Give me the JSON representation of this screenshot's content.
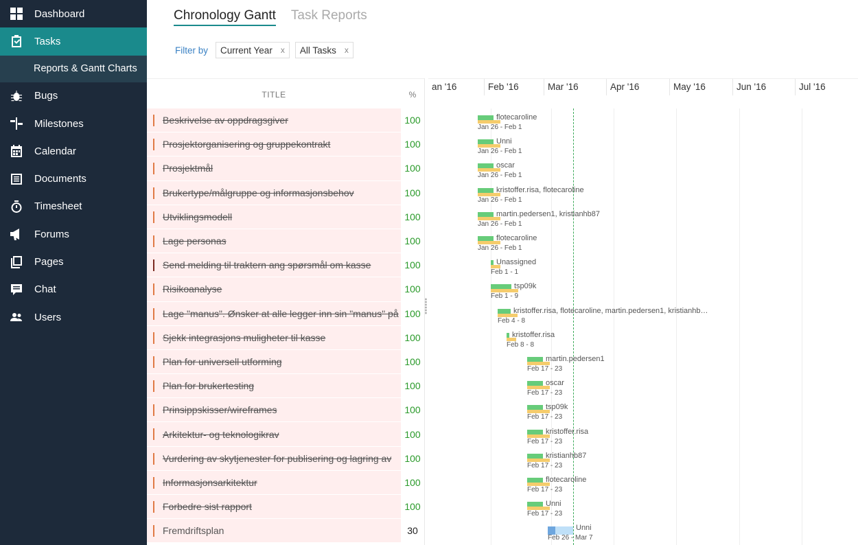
{
  "sidebar": {
    "items": [
      {
        "label": "Dashboard",
        "icon": "dashboard-icon"
      },
      {
        "label": "Tasks",
        "icon": "tasks-icon"
      },
      {
        "label": "Reports & Gantt Charts",
        "icon": ""
      },
      {
        "label": "Bugs",
        "icon": "bug-icon"
      },
      {
        "label": "Milestones",
        "icon": "milestones-icon"
      },
      {
        "label": "Calendar",
        "icon": "calendar-icon"
      },
      {
        "label": "Documents",
        "icon": "documents-icon"
      },
      {
        "label": "Timesheet",
        "icon": "timesheet-icon"
      },
      {
        "label": "Forums",
        "icon": "forums-icon"
      },
      {
        "label": "Pages",
        "icon": "pages-icon"
      },
      {
        "label": "Chat",
        "icon": "chat-icon"
      },
      {
        "label": "Users",
        "icon": "users-icon"
      }
    ]
  },
  "header": {
    "tabs": [
      {
        "label": "Chronology Gantt"
      },
      {
        "label": "Task Reports"
      }
    ],
    "filter_label": "Filter by",
    "filters": [
      {
        "label": "Current Year",
        "remove": "x"
      },
      {
        "label": "All Tasks",
        "remove": "x"
      }
    ]
  },
  "grid": {
    "col_title": "TITLE",
    "col_pct": "%",
    "rows": [
      {
        "title": "Beskrivelse av oppdragsgiver",
        "pct": "100"
      },
      {
        "title": "Prosjektorganisering og gruppekontrakt",
        "pct": "100"
      },
      {
        "title": "Prosjektmål",
        "pct": "100"
      },
      {
        "title": "Brukertype/målgruppe og informasjonsbehov",
        "pct": "100"
      },
      {
        "title": "Utviklingsmodell",
        "pct": "100"
      },
      {
        "title": "Lage personas",
        "pct": "100"
      },
      {
        "title": "Send melding til traktern ang spørsmål om kasse",
        "pct": "100"
      },
      {
        "title": "Risikoanalyse",
        "pct": "100"
      },
      {
        "title": "Lage \"manus\". Ønsker at alle legger inn sin \"manus\" på",
        "pct": "100"
      },
      {
        "title": "Sjekk integrasjons muligheter til kasse",
        "pct": "100"
      },
      {
        "title": "Plan for universell utforming",
        "pct": "100"
      },
      {
        "title": "Plan for brukertesting",
        "pct": "100"
      },
      {
        "title": "Prinsippskisser/wireframes",
        "pct": "100"
      },
      {
        "title": "Arkitektur- og teknologikrav",
        "pct": "100"
      },
      {
        "title": "Vurdering av skytjenester for publisering og lagring av",
        "pct": "100"
      },
      {
        "title": "Informasjonsarkitektur",
        "pct": "100"
      },
      {
        "title": "Forbedre sist rapport",
        "pct": "100"
      },
      {
        "title": "Fremdriftsplan",
        "pct": "30"
      }
    ]
  },
  "gantt": {
    "months": [
      "an '16",
      "Feb '16",
      "Mar '16",
      "Apr '16",
      "May '16",
      "Jun '16",
      "Jul '16"
    ],
    "bars": [
      {
        "name": "flotecaroline",
        "dates": "Jan 26 - Feb 1",
        "progress": 1.0
      },
      {
        "name": "Unni",
        "dates": "Jan 26 - Feb 1",
        "progress": 1.0
      },
      {
        "name": "oscar",
        "dates": "Jan 26 - Feb 1",
        "progress": 1.0
      },
      {
        "name": "kristoffer.risa, flotecaroline",
        "dates": "Jan 26 - Feb 1",
        "progress": 1.0
      },
      {
        "name": "martin.pedersen1, kristianhb87",
        "dates": "Jan 26 - Feb 1",
        "progress": 1.0
      },
      {
        "name": "flotecaroline",
        "dates": "Jan 26 - Feb 1",
        "progress": 1.0
      },
      {
        "name": "Unassigned",
        "dates": "Feb 1 - 1",
        "progress": 1.0
      },
      {
        "name": "tsp09k",
        "dates": "Feb 1 - 9",
        "progress": 1.0
      },
      {
        "name": "kristoffer.risa, flotecaroline, martin.pedersen1, kristianhb…",
        "dates": "Feb 4 - 8",
        "progress": 1.0
      },
      {
        "name": "kristoffer.risa",
        "dates": "Feb 8 - 8",
        "progress": 1.0
      },
      {
        "name": "martin.pedersen1",
        "dates": "Feb 17 - 23",
        "progress": 1.0
      },
      {
        "name": "oscar",
        "dates": "Feb 17 - 23",
        "progress": 1.0
      },
      {
        "name": "tsp09k",
        "dates": "Feb 17 - 23",
        "progress": 1.0
      },
      {
        "name": "kristoffer.risa",
        "dates": "Feb 17 - 23",
        "progress": 1.0
      },
      {
        "name": "kristianhb87",
        "dates": "Feb 17 - 23",
        "progress": 1.0
      },
      {
        "name": "flotecaroline",
        "dates": "Feb 17 - 23",
        "progress": 1.0
      },
      {
        "name": "Unni",
        "dates": "Feb 17 - 23",
        "progress": 1.0
      },
      {
        "name": "Unni",
        "dates": "Feb 26 - Mar 7",
        "progress": 0.3
      }
    ]
  },
  "colors": {
    "sidebar_bg": "#1d2a3a",
    "active_nav": "#1a8a8c",
    "done_green": "#67cc7a",
    "bar_yellow": "#f5cc6c",
    "open_blue": "#bfe0f8"
  }
}
